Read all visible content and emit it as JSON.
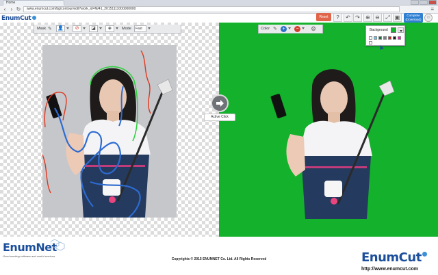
{
  "browser": {
    "tab_title": "Home",
    "url": "www.enumcut.com/bg/contour/edit?work_id=M/41_20151111000000000",
    "back_icon": "back-arrow-icon",
    "forward_icon": "forward-arrow-icon",
    "reload_icon": "reload-icon",
    "menu_icon": "menu-icon"
  },
  "header": {
    "logo_text": "EnumCut",
    "reset_label": "Reset",
    "help_icon": "question-icon",
    "undo_icon": "undo-icon",
    "redo_icon": "redo-icon",
    "zoom_in_icon": "zoom-in-icon",
    "zoom_out_icon": "zoom-out-icon",
    "fit_icon": "fit-screen-icon",
    "fullscreen_icon": "fullscreen-icon",
    "complete_label": "Complete",
    "complete_sublabel": "(Download)",
    "accent_color": "#2e7fd1",
    "reset_color": "#e0654a"
  },
  "mask_toolbar": {
    "label": "Mask",
    "mode_label": "Mode",
    "mode_value": "Fast"
  },
  "color_toolbar": {
    "label": "Color"
  },
  "background_popup": {
    "label": "Background",
    "current_color": "#13b12c",
    "swatches": [
      "#ffffff",
      "#6cc1e6",
      "#1c6b39",
      "#7a7f8a",
      "#c9261d",
      "#1a1a1a",
      "#e22ab0",
      "#ffffff"
    ]
  },
  "active_click": {
    "label": "Active Click"
  },
  "footer": {
    "brand": "EnumNet",
    "tagline": "Good working  software and  useful services",
    "copyright": "Copyrights © 2015 ENUMNET Co. Ltd. All Rights Reserved",
    "logo_text": "EnumCut",
    "url": "http://www.enumcut.com"
  }
}
